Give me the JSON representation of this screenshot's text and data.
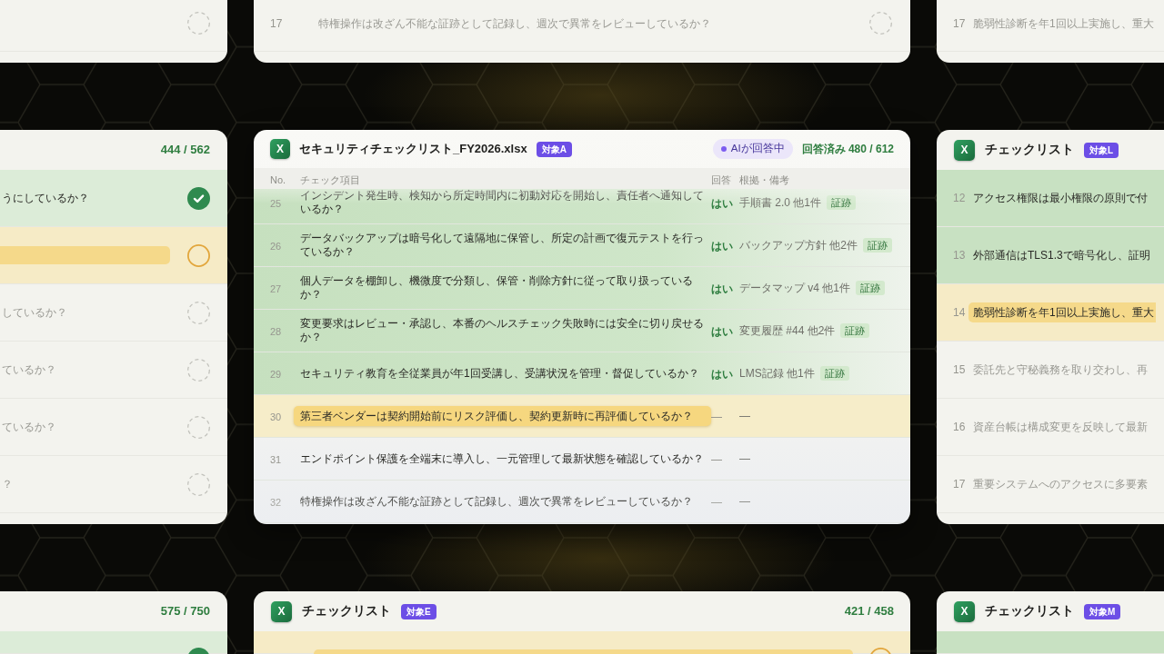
{
  "cards": [
    {
      "kind": "compact",
      "rows": [
        {
          "kind": "pending"
        }
      ]
    },
    {
      "kind": "compact",
      "rows": [
        {
          "number": "17",
          "text": "特権操作は改ざん不能な証跡として記録し、週次で異常をレビューしているか？",
          "kind": "pending"
        }
      ]
    },
    {
      "kind": "compact",
      "rows": [
        {
          "number": "17",
          "text": "脆弱性診断を年1回以上実施し、重大",
          "kind": "pending"
        }
      ]
    },
    {
      "kind": "compact",
      "count": "444 / 562",
      "rows": [
        {
          "text": "うにしているか？",
          "kind": "done"
        },
        {
          "kind": "active"
        },
        {
          "text": "しているか？",
          "kind": "pending"
        },
        {
          "text": "ているか？",
          "kind": "pending"
        },
        {
          "text": "ているか？",
          "kind": "pending"
        },
        {
          "text": "？",
          "kind": "pending"
        }
      ]
    },
    {
      "kind": "detail",
      "logo": "X",
      "title": "セキュリティチェックリスト_FY2026.xlsx",
      "badge": "対象A",
      "ai_status": "AIが回答中",
      "count": "回答済み 480 / 612",
      "columns": [
        "No.",
        "チェック項目",
        "回答",
        "根拠・備考"
      ],
      "rows": [
        {
          "number": "25",
          "text": "インシデント発生時、検知から所定時間内に初動対応を開始し、責任者へ通知しているか？",
          "kind": "done",
          "answer": "はい",
          "evidence": "手順書 2.0 他1件",
          "tag": "証跡"
        },
        {
          "number": "26",
          "text": "データバックアップは暗号化して遠隔地に保管し、所定の計画で復元テストを行っているか？",
          "kind": "done",
          "answer": "はい",
          "evidence": "バックアップ方針 他2件",
          "tag": "証跡"
        },
        {
          "number": "27",
          "text": "個人データを棚卸し、機微度で分類し、保管・削除方針に従って取り扱っているか？",
          "kind": "done",
          "answer": "はい",
          "evidence": "データマップ v4 他1件",
          "tag": "証跡"
        },
        {
          "number": "28",
          "text": "変更要求はレビュー・承認し、本番のヘルスチェック失敗時には安全に切り戻せるか？",
          "kind": "done",
          "answer": "はい",
          "evidence": "変更履歴 #44 他2件",
          "tag": "証跡"
        },
        {
          "number": "29",
          "text": "セキュリティ教育を全従業員が年1回受講し、受講状況を管理・督促しているか？",
          "kind": "done",
          "answer": "はい",
          "evidence": "LMS記録 他1件",
          "tag": "証跡"
        },
        {
          "number": "30",
          "text": "第三者ベンダーは契約開始前にリスク評価し、契約更新時に再評価しているか？",
          "kind": "active",
          "answer": "—",
          "evidence": "—"
        },
        {
          "number": "31",
          "text": "エンドポイント保護を全端末に導入し、一元管理して最新状態を確認しているか？",
          "kind": "pending",
          "answer": "—",
          "evidence": "—"
        },
        {
          "number": "32",
          "text": "特権操作は改ざん不能な証跡として記録し、週次で異常をレビューしているか？",
          "kind": "pending",
          "answer": "—",
          "evidence": "—"
        }
      ]
    },
    {
      "kind": "compact",
      "logo": "X",
      "title": "チェックリスト",
      "badge": "対象L",
      "rows": [
        {
          "number": "12",
          "text": "アクセス権限は最小権限の原則で付",
          "kind": "done"
        },
        {
          "number": "13",
          "text": "外部通信はTLS1.3で暗号化し、証明",
          "kind": "done"
        },
        {
          "number": "14",
          "text": "脆弱性診断を年1回以上実施し、重大",
          "kind": "active"
        },
        {
          "number": "15",
          "text": "委託先と守秘義務を取り交わし、再",
          "kind": "pending"
        },
        {
          "number": "16",
          "text": "資産台帳は構成変更を反映して最新",
          "kind": "pending"
        },
        {
          "number": "17",
          "text": "重要システムへのアクセスに多要素",
          "kind": "pending"
        }
      ]
    },
    {
      "kind": "compact",
      "count": "575 / 750",
      "rows": [
        {
          "kind": "done"
        }
      ]
    },
    {
      "kind": "compact",
      "logo": "X",
      "title": "チェックリスト",
      "badge": "対象E",
      "count": "421 / 458",
      "rows": [
        {
          "kind": "active"
        }
      ]
    },
    {
      "kind": "compact",
      "logo": "X",
      "title": "チェックリスト",
      "badge": "対象M",
      "rows": [
        {
          "kind": "done"
        }
      ]
    }
  ]
}
